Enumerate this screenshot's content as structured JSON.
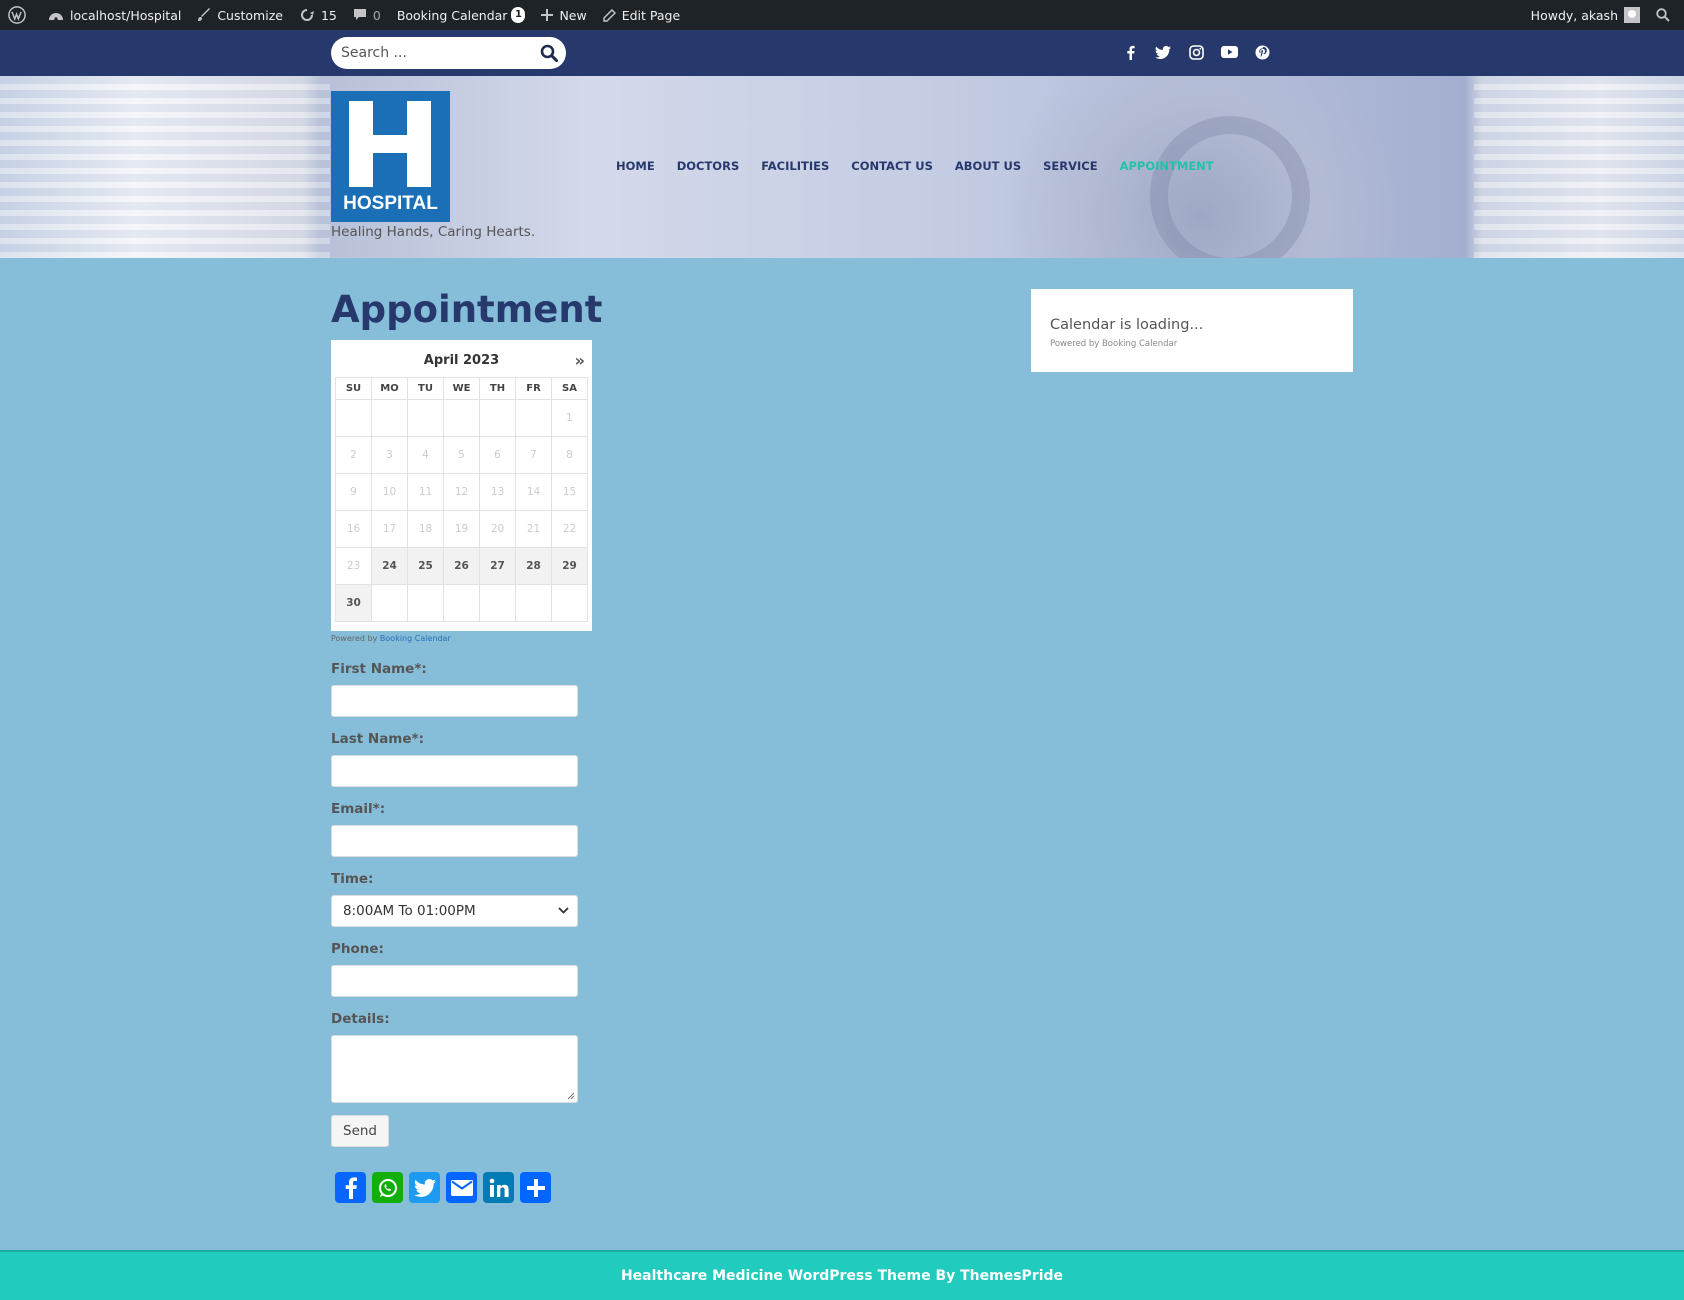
{
  "admin_bar": {
    "site": "localhost/Hospital",
    "customize": "Customize",
    "updates_count": "15",
    "comments_count": "0",
    "booking_calendar": "Booking Calendar",
    "booking_badge": "1",
    "new": "New",
    "edit_page": "Edit Page",
    "howdy": "Howdy, akash"
  },
  "topbar": {
    "search_placeholder": "Search ...",
    "social_icons": [
      "facebook-icon",
      "twitter-icon",
      "instagram-icon",
      "youtube-icon",
      "pinterest-icon"
    ]
  },
  "header": {
    "logo_text": "HOSPITAL",
    "tagline": "Healing Hands, Caring Hearts.",
    "nav": [
      "HOME",
      "DOCTORS",
      "FACILITIES",
      "CONTACT US",
      "ABOUT US",
      "SERVICE",
      "APPOINTMENT"
    ],
    "active_nav": "APPOINTMENT"
  },
  "page": {
    "title": "Appointment"
  },
  "calendar": {
    "month": "April 2023",
    "next": "»",
    "weekdays": [
      "SU",
      "MO",
      "TU",
      "WE",
      "TH",
      "FR",
      "SA"
    ],
    "days": [
      [
        "",
        "",
        "",
        "",
        "",
        "",
        "1"
      ],
      [
        "2",
        "3",
        "4",
        "5",
        "6",
        "7",
        "8"
      ],
      [
        "9",
        "10",
        "11",
        "12",
        "13",
        "14",
        "15"
      ],
      [
        "16",
        "17",
        "18",
        "19",
        "20",
        "21",
        "22"
      ],
      [
        "23",
        "24",
        "25",
        "26",
        "27",
        "28",
        "29"
      ],
      [
        "30",
        "",
        "",
        "",
        "",
        "",
        ""
      ]
    ],
    "available_days": [
      "24",
      "25",
      "26",
      "27",
      "28",
      "29",
      "30"
    ],
    "powered_by": "Powered by",
    "powered_link": "Booking Calendar"
  },
  "form": {
    "first_name_label": "First Name*:",
    "last_name_label": "Last Name*:",
    "email_label": "Email*:",
    "time_label": "Time:",
    "time_value": "8:00AM To 01:00PM",
    "phone_label": "Phone:",
    "details_label": "Details:",
    "send_label": "Send"
  },
  "share": {
    "buttons": [
      "facebook-share",
      "whatsapp-share",
      "twitter-share",
      "email-share",
      "linkedin-share",
      "more-share"
    ]
  },
  "sidebar": {
    "loading_text": "Calendar is loading...",
    "powered_text": "Powered by Booking Calendar"
  },
  "footer": {
    "text": "Healthcare Medicine WordPress Theme By ThemesPride"
  },
  "colors": {
    "page_bg": "#86bed9",
    "topbar": "#27396c",
    "accent": "#21c3a8",
    "footer": "#21ccbf",
    "logo": "#1b6fb6"
  }
}
